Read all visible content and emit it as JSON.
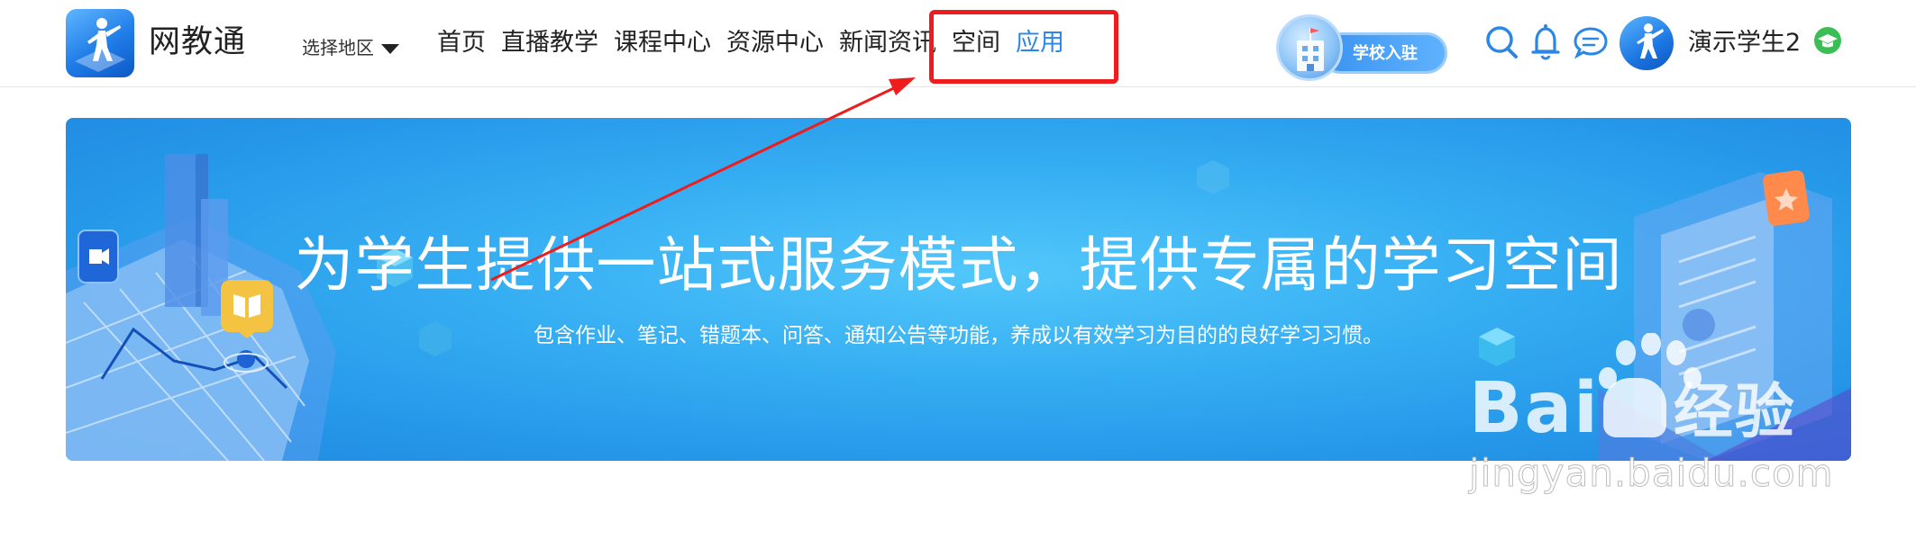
{
  "header": {
    "site_name": "网教通",
    "region_selector": {
      "label": "选择地区"
    },
    "nav": [
      {
        "label": "首页"
      },
      {
        "label": "直播教学"
      },
      {
        "label": "课程中心"
      },
      {
        "label": "资源中心"
      },
      {
        "label": "新闻资讯"
      },
      {
        "label": "空间"
      },
      {
        "label": "应用",
        "active": true
      }
    ],
    "school_entry_label": "学校入驻",
    "icons": [
      "search-icon",
      "bell-icon",
      "message-icon"
    ],
    "user": {
      "name": "演示学生2",
      "badge_icon": "graduation-cap-icon"
    }
  },
  "banner": {
    "title": "为学生提供一站式服务模式，提供专属的学习空间",
    "subtitle": "包含作业、笔记、错题本、问答、通知公告等功能，养成以有效学习为目的的良好学习习惯。"
  },
  "annotation": {
    "color": "#ee1c1c"
  },
  "watermark": {
    "brand_latin": "Bai",
    "brand_cn": "经验",
    "url": "jingyan.baidu.com"
  },
  "colors": {
    "accent": "#2a87e6",
    "banner": "#35adf2",
    "badge": "#3bbf55"
  }
}
